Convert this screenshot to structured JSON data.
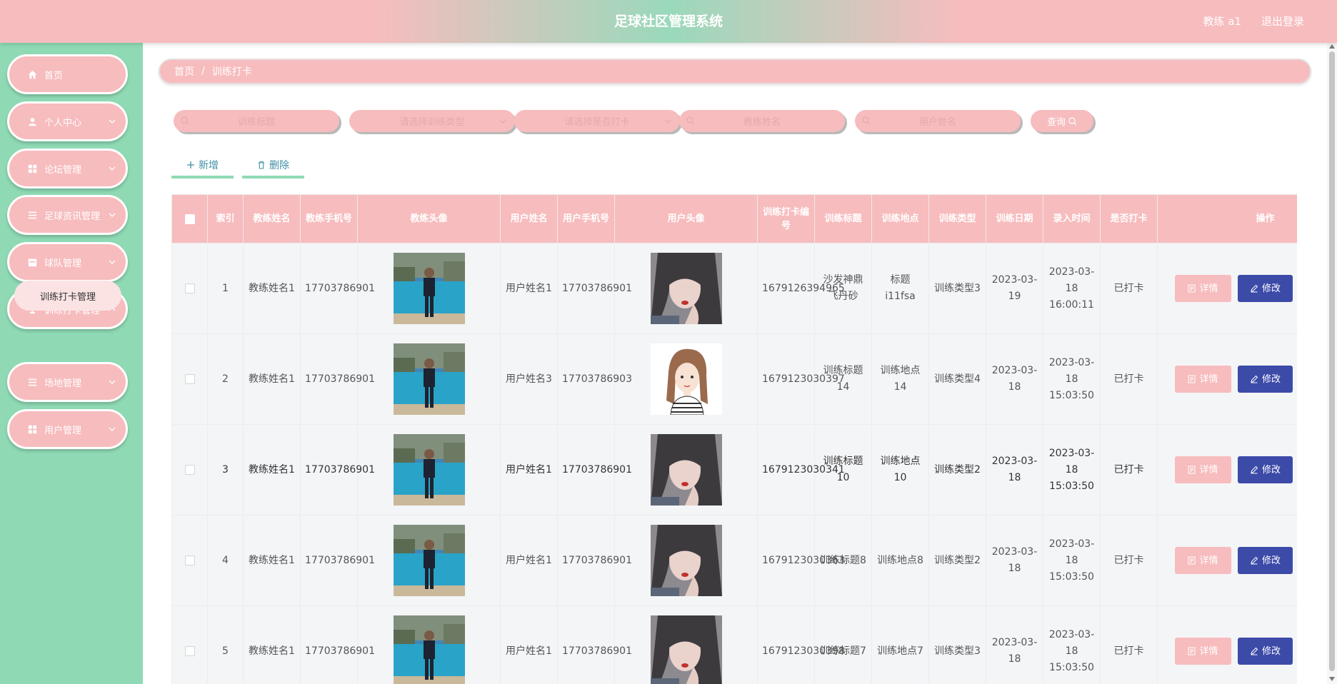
{
  "header": {
    "title": "足球社区管理系统",
    "user": "教练 a1",
    "logout": "退出登录"
  },
  "sidebar": {
    "items": [
      {
        "label": "首页",
        "icon": "home-icon"
      },
      {
        "label": "个人中心",
        "icon": "user-icon"
      },
      {
        "label": "论坛管理",
        "icon": "grid-icon"
      },
      {
        "label": "足球资讯管理",
        "icon": "list-icon"
      },
      {
        "label": "球队管理",
        "icon": "calendar-icon"
      },
      {
        "label": "训练打卡管理",
        "icon": "trophy-icon"
      },
      {
        "label": "场地管理",
        "icon": "list-icon"
      },
      {
        "label": "用户管理",
        "icon": "grid-icon"
      }
    ],
    "submenu": {
      "label": "训练打卡管理"
    }
  },
  "breadcrumb": {
    "home": "首页",
    "sep": "/",
    "current": "训练打卡"
  },
  "search": {
    "title_placeholder": "训练标题",
    "type_placeholder": "请选择训练类型",
    "checked_placeholder": "请选择是否打卡",
    "coach_placeholder": "教练姓名",
    "user_placeholder": "用户姓名",
    "query_label": "查询"
  },
  "actions": {
    "add": "新增",
    "delete": "删除"
  },
  "table": {
    "headers": [
      "索引",
      "教练姓名",
      "教练手机号",
      "教练头像",
      "用户姓名",
      "用户手机号",
      "用户头像",
      "训练打卡编号",
      "训练标题",
      "训练地点",
      "训练类型",
      "训练日期",
      "录入时间",
      "是否打卡",
      "操作"
    ],
    "detail_label": "详情",
    "edit_label": "修改",
    "rows": [
      {
        "index": "1",
        "coach_name": "教练姓名1",
        "coach_phone": "17703786901",
        "user_name": "用户姓名1",
        "user_phone": "17703786901",
        "avatar": "girl-photo",
        "code": "1679126394965",
        "title": "沙发神鼎飞丹砂",
        "place": "标题i11fsa",
        "type": "训练类型3",
        "date": "2023-03-19",
        "created": "2023-03-18 16:00:11",
        "checked": "已打卡"
      },
      {
        "index": "2",
        "coach_name": "教练姓名1",
        "coach_phone": "17703786901",
        "user_name": "用户姓名3",
        "user_phone": "17703786903",
        "avatar": "cartoon-girl",
        "code": "1679123030397",
        "title": "训练标题14",
        "place": "训练地点14",
        "type": "训练类型4",
        "date": "2023-03-18",
        "created": "2023-03-18 15:03:50",
        "checked": "已打卡"
      },
      {
        "index": "3",
        "coach_name": "教练姓名1",
        "coach_phone": "17703786901",
        "user_name": "用户姓名1",
        "user_phone": "17703786901",
        "avatar": "girl-photo",
        "code": "1679123030341",
        "title": "训练标题10",
        "place": "训练地点10",
        "type": "训练类型2",
        "date": "2023-03-18",
        "created": "2023-03-18 15:03:50",
        "checked": "已打卡"
      },
      {
        "index": "4",
        "coach_name": "教练姓名1",
        "coach_phone": "17703786901",
        "user_name": "用户姓名1",
        "user_phone": "17703786901",
        "avatar": "girl-photo",
        "code": "1679123030363",
        "title": "训练标题8",
        "place": "训练地点8",
        "type": "训练类型2",
        "date": "2023-03-18",
        "created": "2023-03-18 15:03:50",
        "checked": "已打卡"
      },
      {
        "index": "5",
        "coach_name": "教练姓名1",
        "coach_phone": "17703786901",
        "user_name": "用户姓名1",
        "user_phone": "17703786901",
        "avatar": "girl-photo",
        "code": "1679123030398",
        "title": "训练标题7",
        "place": "训练地点7",
        "type": "训练类型3",
        "date": "2023-03-18",
        "created": "2023-03-18 15:03:50",
        "checked": "已打卡"
      }
    ]
  },
  "colors": {
    "pink": "#f7bcbe",
    "green": "#8fdab5",
    "edit_blue": "#3c4aa8"
  }
}
